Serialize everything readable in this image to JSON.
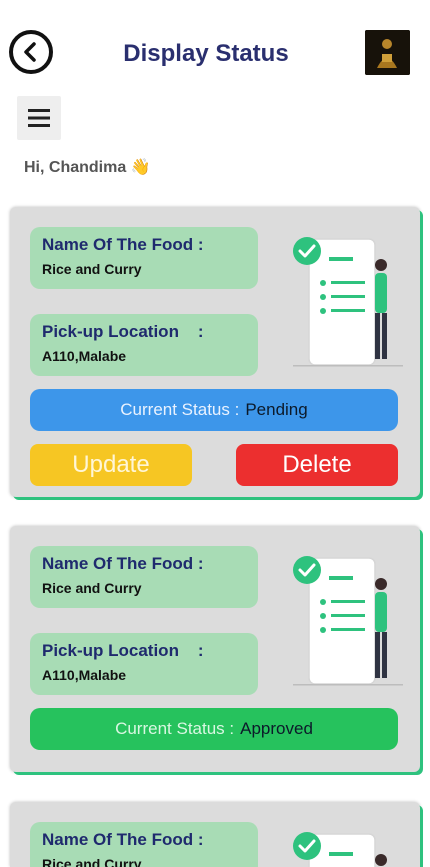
{
  "header": {
    "title": "Display Status",
    "back_icon": "back-arrow-icon",
    "logo_icon": "app-logo"
  },
  "menu": {
    "icon": "hamburger-menu-icon"
  },
  "greeting": {
    "text": "Hi, Chandima",
    "emoji": "👋"
  },
  "labels": {
    "food_name": "Name Of The Food :",
    "pickup": "Pick-up Location    :",
    "status_label": "Current Status  :",
    "update": "Update",
    "delete": "Delete"
  },
  "cards": [
    {
      "food_name": "Rice and Curry",
      "pickup_location": "A110,Malabe",
      "status": "Pending"
    },
    {
      "food_name": "Rice and Curry",
      "pickup_location": "A110,Malabe",
      "status": "Approved"
    },
    {
      "food_name": "Rice and Curry"
    }
  ],
  "colors": {
    "card_bg": "#dcdcdc",
    "field_bg": "#a8dcb5",
    "pending": "#3d96ea",
    "approved": "#26c25d",
    "update": "#f6c623",
    "delete": "#ec2f2f",
    "title": "#2a2f6f"
  }
}
